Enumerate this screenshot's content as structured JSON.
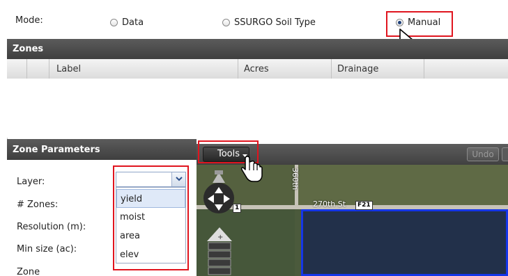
{
  "mode": {
    "label": "Mode:",
    "options": [
      {
        "label": "Data",
        "checked": false
      },
      {
        "label": "SSURGO Soil Type",
        "checked": false
      },
      {
        "label": "Manual",
        "checked": true
      }
    ]
  },
  "zones": {
    "title": "Zones",
    "columns": [
      "",
      "",
      "Label",
      "Acres",
      "Drainage",
      ""
    ],
    "rows": []
  },
  "zone_params": {
    "title": "Zone Parameters",
    "fields": [
      {
        "label": "Layer:"
      },
      {
        "label": "# Zones:"
      },
      {
        "label": "Resolution (m):"
      },
      {
        "label": "Min size (ac):"
      },
      {
        "label": "Zone"
      }
    ],
    "layer_select": {
      "value": "",
      "options": [
        "yield",
        "moist",
        "area",
        "elev"
      ],
      "highlighted": "yield"
    }
  },
  "map": {
    "tools_label": "Tools",
    "undo_label": "Undo",
    "road_vertical": "360th",
    "road_horizontal": "270th St",
    "route_tag": "F21",
    "partial_tag": "1"
  },
  "colors": {
    "highlight": "#e0141e",
    "header": "#4a4a4a",
    "field_outline": "#1536e8"
  }
}
